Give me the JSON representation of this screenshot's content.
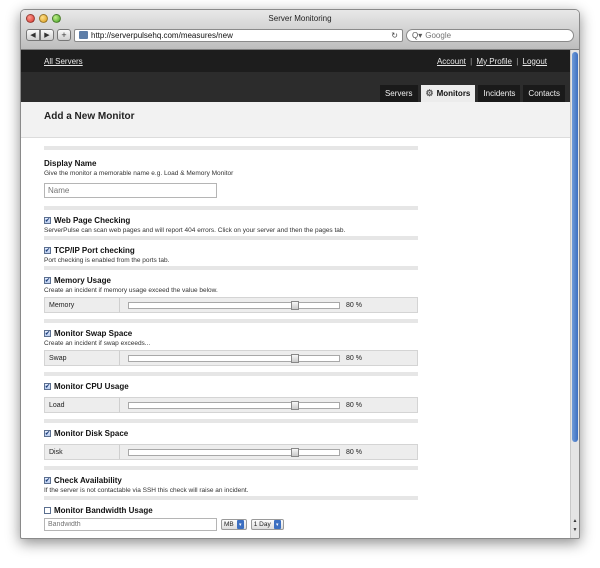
{
  "window": {
    "title": "Server Monitoring"
  },
  "browser": {
    "url": "http://serverpulsehq.com/measures/new",
    "search_placeholder": "Google",
    "back_glyph": "◀",
    "forward_glyph": "▶",
    "add_glyph": "+",
    "reload_glyph": "↻",
    "search_glyph": "Q▾"
  },
  "topbar": {
    "left_link": "All Servers",
    "account": "Account",
    "profile": "My Profile",
    "logout": "Logout",
    "separator": "|"
  },
  "tabs": [
    {
      "label": "Servers"
    },
    {
      "label": "Monitors",
      "icon": "gear-icon"
    },
    {
      "label": "Incidents"
    },
    {
      "label": "Contacts"
    }
  ],
  "page": {
    "title": "Add a New Monitor"
  },
  "display_name": {
    "title": "Display Name",
    "desc": "Give the monitor a memorable name e.g. Load & Memory Monitor",
    "placeholder": "Name"
  },
  "web_page": {
    "title": "Web Page Checking",
    "desc": "ServerPulse can scan web pages and will report 404 errors. Click on your server and then the pages tab.",
    "checked": true
  },
  "tcp_ip": {
    "title": "TCP/IP Port checking",
    "desc": "Port checking is enabled from the ports tab.",
    "checked": true
  },
  "memory": {
    "title": "Memory Usage",
    "desc": "Create an incident if memory usage exceed the value below.",
    "label": "Memory",
    "value": "80 %",
    "level": 0.8,
    "checked": true
  },
  "swap": {
    "title": "Monitor Swap Space",
    "desc": "Create an incident if swap exceeds...",
    "label": "Swap",
    "value": "80 %",
    "level": 0.8,
    "checked": true
  },
  "cpu": {
    "title": "Monitor CPU Usage",
    "label": "Load",
    "value": "80 %",
    "level": 0.8,
    "checked": true
  },
  "disk": {
    "title": "Monitor Disk Space",
    "label": "Disk",
    "value": "80 %",
    "level": 0.8,
    "checked": true
  },
  "availability": {
    "title": "Check Availability",
    "desc": "If the server is not contactable via SSH this check will raise an incident.",
    "checked": true
  },
  "bandwidth": {
    "title": "Monitor Bandwidth Usage",
    "placeholder": "Bandwidth",
    "unit": "MB",
    "period": "1 Day",
    "checked": false
  },
  "colors": {
    "topbar": "#1d1d1d",
    "tabsbar": "#2c2c2c",
    "scroll_thumb": "#3c6fc1"
  }
}
